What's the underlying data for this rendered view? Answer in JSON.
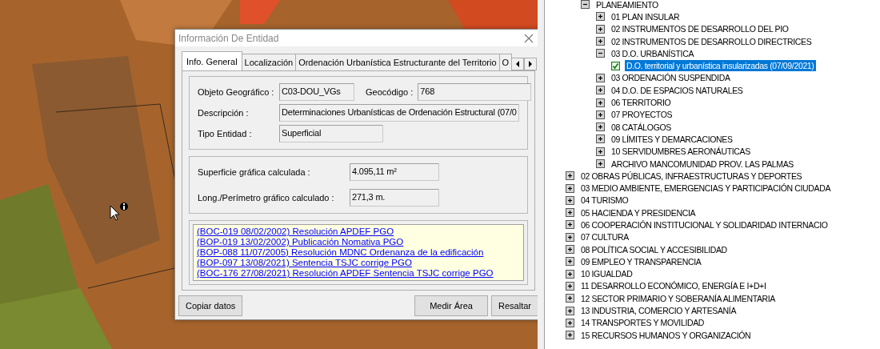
{
  "dialog": {
    "title": "Información De Entidad",
    "tabs": [
      {
        "label": "Info. General",
        "selected": true
      },
      {
        "label": "Localización",
        "selected": false
      },
      {
        "label": "Ordenación Urbanística Estructurante del Territorio",
        "selected": false
      },
      {
        "label": "O",
        "selected": false
      }
    ],
    "general": [
      [
        {
          "label": "Objeto Geográfico :",
          "value": "C03-DOU_VGs"
        },
        {
          "label": "Geocódigo :",
          "value": "768"
        }
      ],
      [
        {
          "label": "Descripción :",
          "value": "Determinaciones Urbanísticas de Ordenación Estructural (07/0"
        }
      ],
      [
        {
          "label": "Tipo Entidad :",
          "value": "Superficial"
        }
      ]
    ],
    "measurements": [
      {
        "label": "Superficie gráfica calculada :",
        "value": "4.095,11 m²"
      },
      {
        "label": "Long./Perímetro gráfico calculado :",
        "value": "271,3 m."
      }
    ],
    "links": [
      "(BOC-019 08/02/2002) Resolución APDEF PGO",
      "(BOP-019 13/02/2002) Publicación Nomativa PGO",
      "(BOP-088 11/07/2005) Resolución MDNC Ordenanza de la edificación",
      "(BOP-097 13/08/2021) Sentencia TSJC corrige PGO",
      "(BOC-176 27/08/2021) Resolución APDEF Sentencia TSJC corrige PGO"
    ],
    "buttons": [
      "Copiar datos",
      "Medir Área",
      "Resaltar"
    ]
  },
  "tree": [
    {
      "children": [
        {
          "label": "PLANEAMIENTO",
          "kind": "folder",
          "expanded": true,
          "selected": false,
          "children": [
            {
              "label": "01 PLAN INSULAR",
              "kind": "folder",
              "expanded": false,
              "selected": false
            },
            {
              "label": "02 INSTRUMENTOS DE DESARROLLO DEL PIO",
              "kind": "folder",
              "expanded": false,
              "selected": false
            },
            {
              "label": "02 INSTRUMENTOS DE DESARROLLO DIRECTRICES",
              "kind": "folder",
              "expanded": false,
              "selected": false
            },
            {
              "label": "03 D.O. URBANÍSTICA",
              "kind": "folder",
              "expanded": true,
              "selected": false,
              "children": [
                {
                  "label": "D.O. territorial y urbanística insularizadas (07/09/2021)",
                  "kind": "layer",
                  "checked": true,
                  "selected": true
                }
              ]
            },
            {
              "label": "03 ORDENACIÓN SUSPENDIDA",
              "kind": "folder",
              "expanded": false,
              "selected": false
            },
            {
              "label": "04 D.O. DE ESPACIOS NATURALES",
              "kind": "folder",
              "expanded": false,
              "selected": false
            },
            {
              "label": "06 TERRITORIO",
              "kind": "folder",
              "expanded": false,
              "selected": false
            },
            {
              "label": "07 PROYECTOS",
              "kind": "folder",
              "expanded": false,
              "selected": false
            },
            {
              "label": "08 CATÁLOGOS",
              "kind": "folder",
              "expanded": false,
              "selected": false
            },
            {
              "label": "09 LÍMITES Y DEMARCACIONES",
              "kind": "folder",
              "expanded": false,
              "selected": false
            },
            {
              "label": "10 SERVIDUMBRES AERONÁUTICAS",
              "kind": "folder",
              "expanded": false,
              "selected": false
            },
            {
              "label": "ARCHIVO MANCOMUNIDAD PROV. LAS PALMAS",
              "kind": "folder",
              "expanded": false,
              "selected": false
            }
          ]
        }
      ]
    },
    {
      "label": "02 OBRAS PÚBLICAS, INFRAESTRUCTURAS Y DEPORTES",
      "kind": "folder",
      "expanded": false,
      "selected": false
    },
    {
      "label": "03 MEDIO AMBIENTE, EMERGENCIAS Y PARTICIPACIÓN CIUDADA",
      "kind": "folder",
      "expanded": false,
      "selected": false
    },
    {
      "label": "04 TURISMO",
      "kind": "folder",
      "expanded": false,
      "selected": false
    },
    {
      "label": "05 HACIENDA Y PRESIDENCIA",
      "kind": "folder",
      "expanded": false,
      "selected": false
    },
    {
      "label": "06 COOPERACIÓN INSTITUCIONAL Y SOLIDARIDAD INTERNACIO",
      "kind": "folder",
      "expanded": false,
      "selected": false
    },
    {
      "label": "07 CULTURA",
      "kind": "folder",
      "expanded": false,
      "selected": false
    },
    {
      "label": "08 POLÍTICA SOCIAL Y ACCESIBILIDAD",
      "kind": "folder",
      "expanded": false,
      "selected": false
    },
    {
      "label": "09 EMPLEO Y TRANSPARENCIA",
      "kind": "folder",
      "expanded": false,
      "selected": false
    },
    {
      "label": "10 IGUALDAD",
      "kind": "folder",
      "expanded": false,
      "selected": false
    },
    {
      "label": "11 DESARROLLO ECONÓMICO, ENERGÍA E I+D+I",
      "kind": "folder",
      "expanded": false,
      "selected": false
    },
    {
      "label": "12 SECTOR PRIMARIO Y SOBERANÍA ALIMENTARIA",
      "kind": "folder",
      "expanded": false,
      "selected": false
    },
    {
      "label": "13 INDUSTRIA, COMERCIO Y ARTESANÍA",
      "kind": "folder",
      "expanded": false,
      "selected": false
    },
    {
      "label": "14 TRANSPORTES Y MOVILIDAD",
      "kind": "folder",
      "expanded": false,
      "selected": false
    },
    {
      "label": "15 RECURSOS HUMANOS Y ORGANIZACIÓN",
      "kind": "folder",
      "expanded": false,
      "selected": false
    }
  ]
}
